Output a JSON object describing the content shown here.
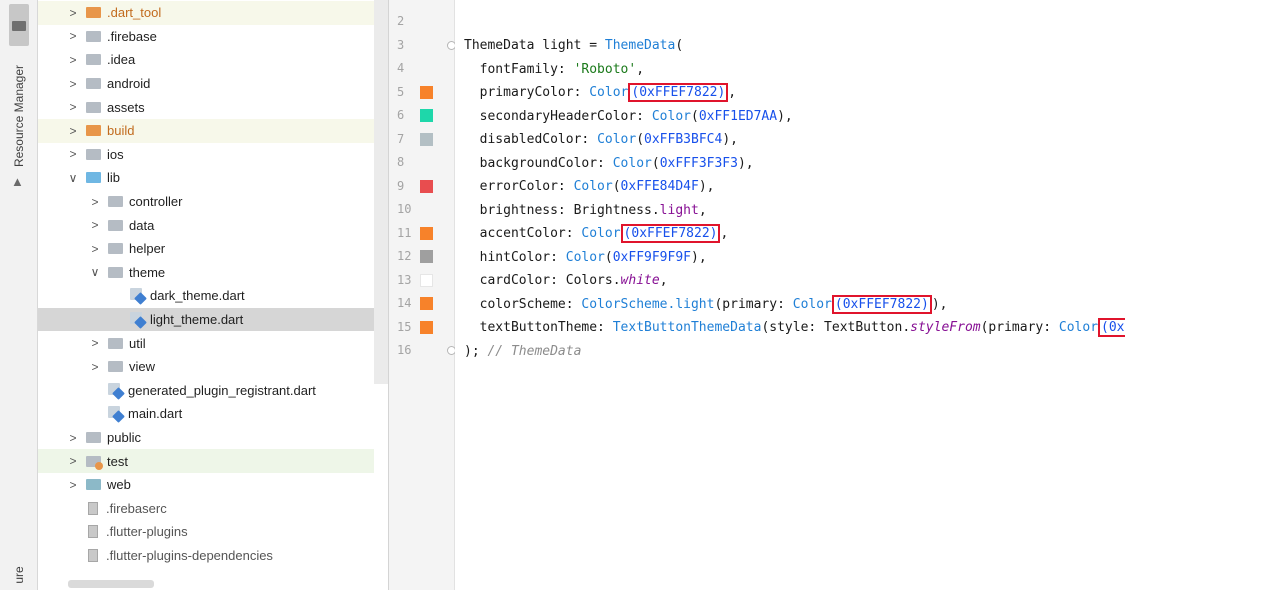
{
  "tool_strip": {
    "resource_manager_label": "Resource Manager",
    "bottom_label": "ure"
  },
  "project_tree": [
    {
      "label": ".dart_tool",
      "arrow": ">",
      "icon": "folder-orange",
      "indent": 0,
      "style": "tint"
    },
    {
      "label": ".firebase",
      "arrow": ">",
      "icon": "folder-gray",
      "indent": 0
    },
    {
      "label": ".idea",
      "arrow": ">",
      "icon": "folder-gray",
      "indent": 0
    },
    {
      "label": "android",
      "arrow": ">",
      "icon": "folder-gray",
      "indent": 0
    },
    {
      "label": "assets",
      "arrow": ">",
      "icon": "folder-gray",
      "indent": 0
    },
    {
      "label": "build",
      "arrow": ">",
      "icon": "folder-orange",
      "indent": 0,
      "style": "tint"
    },
    {
      "label": "ios",
      "arrow": ">",
      "icon": "folder-gray",
      "indent": 0
    },
    {
      "label": "lib",
      "arrow": "∨",
      "icon": "folder-blue",
      "indent": 0
    },
    {
      "label": "controller",
      "arrow": ">",
      "icon": "folder-gray",
      "indent": 1
    },
    {
      "label": "data",
      "arrow": ">",
      "icon": "folder-gray",
      "indent": 1
    },
    {
      "label": "helper",
      "arrow": ">",
      "icon": "folder-gray",
      "indent": 1
    },
    {
      "label": "theme",
      "arrow": "∨",
      "icon": "folder-gray",
      "indent": 1
    },
    {
      "label": "dark_theme.dart",
      "arrow": "",
      "icon": "dart-file",
      "indent": 2
    },
    {
      "label": "light_theme.dart",
      "arrow": "",
      "icon": "dart-file",
      "indent": 2,
      "style": "selected"
    },
    {
      "label": "util",
      "arrow": ">",
      "icon": "folder-gray",
      "indent": 1
    },
    {
      "label": "view",
      "arrow": ">",
      "icon": "folder-gray",
      "indent": 1
    },
    {
      "label": "generated_plugin_registrant.dart",
      "arrow": "",
      "icon": "dart-file",
      "indent": 1
    },
    {
      "label": "main.dart",
      "arrow": "",
      "icon": "dart-file",
      "indent": 1
    },
    {
      "label": "public",
      "arrow": ">",
      "icon": "folder-gray",
      "indent": 0
    },
    {
      "label": "test",
      "arrow": ">",
      "icon": "folder-test",
      "indent": 0,
      "style": "green"
    },
    {
      "label": "web",
      "arrow": ">",
      "icon": "folder-teal",
      "indent": 0
    },
    {
      "label": ".firebaserc",
      "arrow": "",
      "icon": "file",
      "indent": 0
    },
    {
      "label": ".flutter-plugins",
      "arrow": "",
      "icon": "file",
      "indent": 0
    },
    {
      "label": ".flutter-plugins-dependencies",
      "arrow": "",
      "icon": "file",
      "indent": 0
    }
  ],
  "editor": {
    "lines": [
      {
        "num": "2",
        "swatch": null,
        "fold": false
      },
      {
        "num": "3",
        "swatch": null,
        "fold": true
      },
      {
        "num": "4",
        "swatch": null,
        "fold": false
      },
      {
        "num": "5",
        "swatch": "#F7822A",
        "fold": false
      },
      {
        "num": "6",
        "swatch": "#1ED7AA",
        "fold": false
      },
      {
        "num": "7",
        "swatch": "#B3BFC4",
        "fold": false
      },
      {
        "num": "8",
        "swatch": null,
        "fold": false
      },
      {
        "num": "9",
        "swatch": "#E84D4F",
        "fold": false
      },
      {
        "num": "10",
        "swatch": null,
        "fold": false
      },
      {
        "num": "11",
        "swatch": "#F7822A",
        "fold": false
      },
      {
        "num": "12",
        "swatch": "#9F9F9F",
        "fold": false
      },
      {
        "num": "13",
        "swatch": "#FFFFFF",
        "fold": false
      },
      {
        "num": "14",
        "swatch": "#F7822A",
        "fold": false
      },
      {
        "num": "15",
        "swatch": "#F7822A",
        "fold": false
      },
      {
        "num": "16",
        "swatch": null,
        "fold": true
      }
    ],
    "code": {
      "l3": {
        "a": "ThemeData light = ",
        "b": "ThemeData",
        "c": "("
      },
      "l4": {
        "a": "  fontFamily: ",
        "b": "'Roboto'",
        "c": ","
      },
      "l5": {
        "a": "  primaryColor: ",
        "b": "Color",
        "c": "(0xFFEF7822)",
        "d": ","
      },
      "l6": {
        "a": "  secondaryHeaderColor: ",
        "b": "Color",
        "c": "(",
        "d": "0xFF1ED7AA",
        "e": "),"
      },
      "l7": {
        "a": "  disabledColor: ",
        "b": "Color",
        "c": "(",
        "d": "0xFFB3BFC4",
        "e": "),"
      },
      "l8": {
        "a": "  backgroundColor: ",
        "b": "Color",
        "c": "(",
        "d": "0xFFF3F3F3",
        "e": "),"
      },
      "l9": {
        "a": "  errorColor: ",
        "b": "Color",
        "c": "(",
        "d": "0xFFE84D4F",
        "e": "),"
      },
      "l10": {
        "a": "  brightness: Brightness.",
        "b": "light",
        "c": ","
      },
      "l11": {
        "a": "  accentColor: ",
        "b": "Color",
        "c": "(0xFFEF7822)",
        "d": ","
      },
      "l12": {
        "a": "  hintColor: ",
        "b": "Color",
        "c": "(",
        "d": "0xFF9F9F9F",
        "e": "),"
      },
      "l13": {
        "a": "  cardColor: Colors.",
        "b": "white",
        "c": ","
      },
      "l14": {
        "a": "  colorScheme: ",
        "b": "ColorScheme.light",
        "c": "(primary: ",
        "d": "Color",
        "e": "(0xFFEF7822)",
        "f": "),"
      },
      "l15": {
        "a": "  textButtonTheme: ",
        "b": "TextButtonThemeData",
        "c": "(style: TextButton.",
        "d": "styleFrom",
        "e": "(primary: ",
        "f": "Color",
        "g": "(0x"
      },
      "l16": {
        "a": "); ",
        "b": "// ThemeData"
      }
    }
  },
  "colors": {
    "highlight_box": "#E0142C",
    "selection": "#D6D6D6"
  }
}
